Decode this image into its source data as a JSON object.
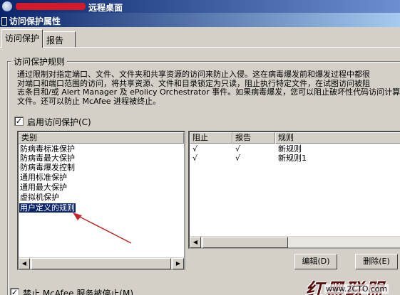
{
  "window": {
    "title": "远程桌面"
  },
  "dialog": {
    "title": "访问保护属性"
  },
  "tabs": [
    {
      "label": "访问保护"
    },
    {
      "label": "报告"
    }
  ],
  "group": {
    "title": "访问保护规则"
  },
  "description": [
    "通过限制对指定端口、文件、文件夹和共享资源的访问来防止入侵。这在病毒爆发前和爆发过程中都很",
    "对端口和端口范围的访问，将共享资源、文件和目录锁定为只读，阻止执行特定文件，在试图访问被阻",
    "志条目和/或 Alert Manager 及 ePolicy Orchestrator 事件。如果病毒爆发，您可以阻止破坏性代码访问计算",
    "文件。还可以防止 McAfee 进程被终止。"
  ],
  "enable_access_protection": {
    "label": "启用访问保护(C)",
    "checked": true
  },
  "categories": {
    "header": "类别",
    "items": [
      "防病毒标准保护",
      "防病毒最大保护",
      "防病毒爆发控制",
      "通用标准保护",
      "通用最大保护",
      "虚拟机保护",
      "用户定义的规则"
    ],
    "selected": "用户定义的规则"
  },
  "rules": {
    "headers": {
      "block": "阻止",
      "report": "报告",
      "rule": "规则"
    },
    "rows": [
      {
        "block": "√",
        "report": "√",
        "rule": "新规则"
      },
      {
        "block": "√",
        "report": "√",
        "rule": "新规则1"
      }
    ]
  },
  "buttons": {
    "edit": "编辑(D)",
    "delete": "删除(E)"
  },
  "prevent_stop": {
    "label": "禁止 McAfee 服务被停止(M)",
    "checked": true
  },
  "watermark": {
    "text": "红黑联盟",
    "site": "www.2CTO.com"
  },
  "colors": {
    "title_bar": "#0a246a",
    "selection": "#0a246a",
    "annotation_arrow": "#c0282a",
    "redaction": "#d11a2a"
  }
}
